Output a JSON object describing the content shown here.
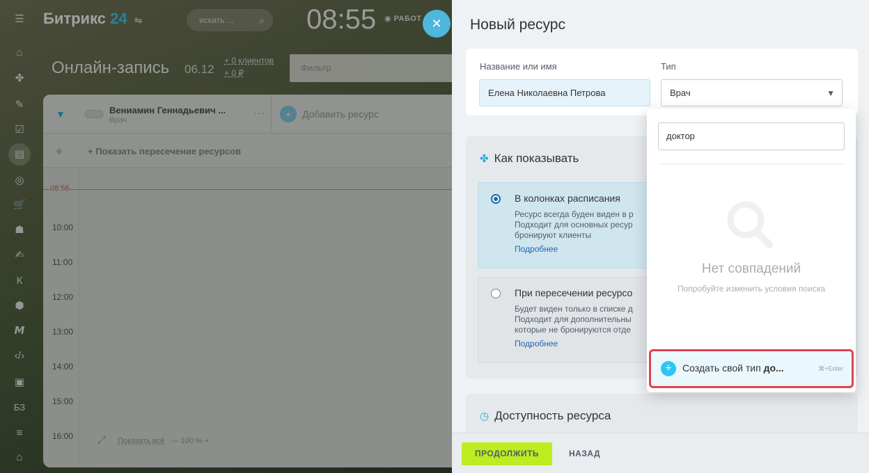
{
  "app": {
    "logo_text": "Битрикс",
    "logo_num": "24",
    "search_placeholder": "искать ...",
    "clock": "08:55",
    "work_status": "РАБОТ",
    "close": "✕"
  },
  "leftbar": {
    "icons": [
      "menu-icon",
      "home-icon",
      "feed-icon",
      "pen-icon",
      "tasks-icon",
      "booking-icon",
      "target-icon",
      "cart-icon",
      "robot-icon",
      "forms-icon",
      "k-icon",
      "box-icon",
      "m-icon",
      "code-icon",
      "id-card-icon",
      "kb-icon",
      "filter-lines-icon",
      "building-icon"
    ],
    "k_label": "К",
    "kb_label": "БЗ"
  },
  "page": {
    "title": "Онлайн-запись",
    "date": "06.12",
    "clients": "+ 0 клиентов",
    "revenue": "+ 0 ₽",
    "filter_placeholder": "Фильтр"
  },
  "calendar": {
    "resource_name": "Вениамин Геннадьевич ...",
    "resource_type": "Врач",
    "more": "···",
    "add_resource": "Добавить ресурс",
    "show_intersection": "+ Показать пересечение ресурсов",
    "now_label": "08:56",
    "times": [
      "10:00",
      "11:00",
      "12:00",
      "13:00",
      "14:00",
      "15:00",
      "16:00"
    ],
    "show_all": "Показать всё",
    "zoom": "— 100 % +"
  },
  "panel": {
    "title": "Новый ресурс",
    "name_label": "Название или имя",
    "type_label": "Тип",
    "name_value": "Елена Николаевна Петрова",
    "type_value": "Врач",
    "how_show_title": "Как показывать",
    "opt1_title": "В колонках расписания",
    "opt1_desc1": "Ресурс всегда буден виден в р",
    "opt1_desc2": "Подходит для основных ресур",
    "opt1_desc3": "бронируют клиенты",
    "opt1_more": "Подробнее",
    "opt2_title": "При пересечении ресурсо",
    "opt2_desc1": "Будет виден только в списке д",
    "opt2_desc2": "Подходит для дополнительны",
    "opt2_desc3": "которые не бронируются отде",
    "opt2_more": "Подробнее",
    "availability_title": "Доступность ресурса",
    "continue_btn": "ПРОДОЛЖИТЬ",
    "back_btn": "НАЗАД"
  },
  "dropdown": {
    "search_value": "доктор",
    "no_match_title": "Нет совпадений",
    "no_match_sub": "Попробуйте изменить условия поиска",
    "create_prefix": "Создать свой тип ",
    "create_query": "до...",
    "create_hint": "⌘+Enter"
  },
  "colors": {
    "accent": "#2fc6f6",
    "continue": "#bbed21",
    "highlight_border": "#e0424e"
  }
}
